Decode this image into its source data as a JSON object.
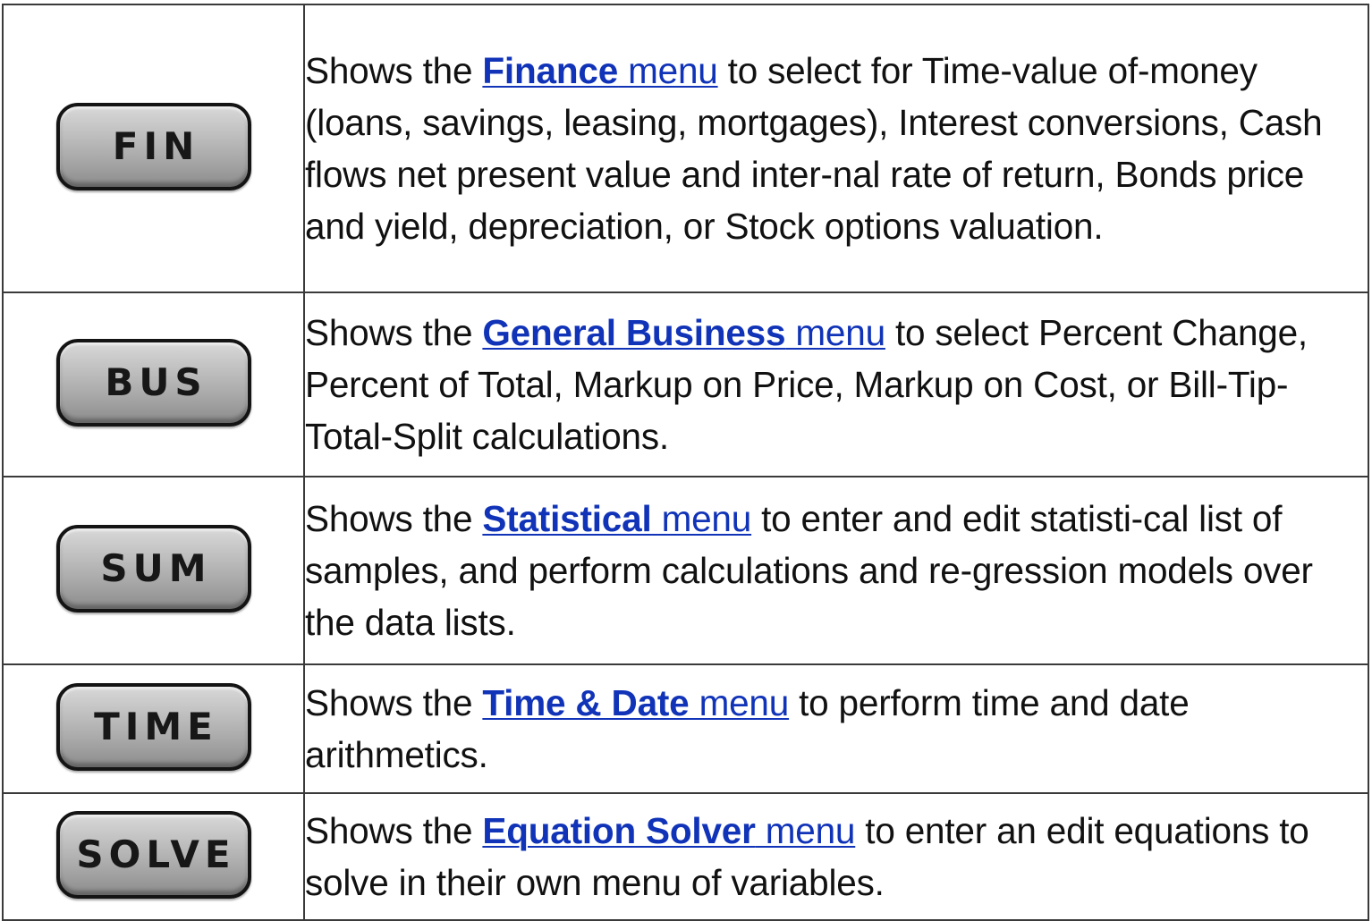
{
  "rows": [
    {
      "key": "FIN",
      "prefix": "Shows the ",
      "link_bold": "Finance",
      "link_plain": " menu",
      "suffix": " to select for Time-value of-money (loans, savings, leasing, mortgages), Interest conversions, Cash flows net present value and inter-nal rate of return, Bonds price and yield, depreciation, or Stock options valuation."
    },
    {
      "key": "BUS",
      "prefix": "Shows the ",
      "link_bold": "General Business",
      "link_plain": " menu",
      "suffix": " to select Percent Change, Percent of Total, Markup on Price, Markup on Cost, or Bill-Tip-Total-Split calculations."
    },
    {
      "key": "SUM",
      "prefix": "Shows the ",
      "link_bold": "Statistical",
      "link_plain": " menu",
      "suffix": " to enter and edit statisti-cal list of samples, and perform calculations and re-gression models over the data lists."
    },
    {
      "key": "TIME",
      "prefix": "Shows the ",
      "link_bold": "Time & Date",
      "link_plain": " menu",
      "suffix": " to perform time and date arithmetics."
    },
    {
      "key": "SOLVE",
      "prefix": "Shows the ",
      "link_bold": "Equation Solver",
      "link_plain": " menu",
      "suffix": " to enter an edit equations to solve in their own menu of variables."
    }
  ],
  "colors": {
    "link": "#1033b8",
    "border": "#3a3a3a",
    "key_face": "#b0b0b0",
    "key_outline": "#141414"
  }
}
